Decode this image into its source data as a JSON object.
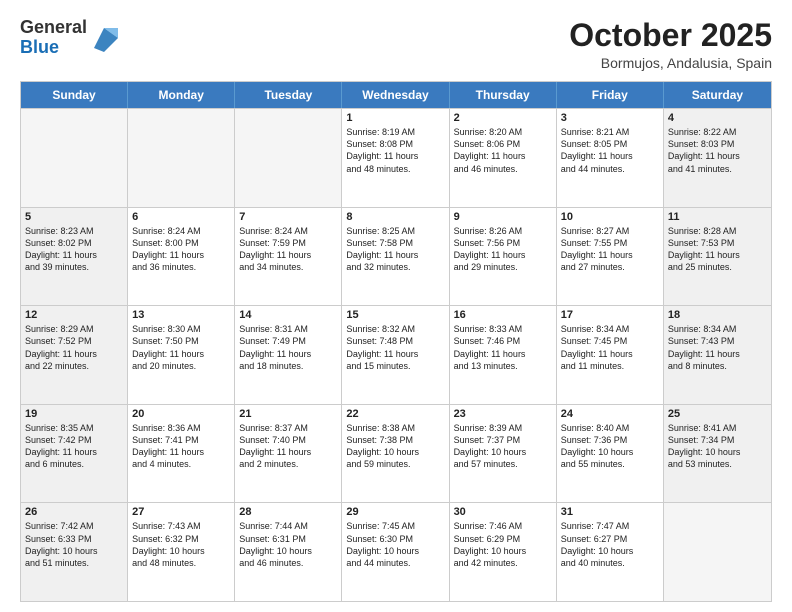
{
  "header": {
    "logo_line1": "General",
    "logo_line2": "Blue",
    "month": "October 2025",
    "location": "Bormujos, Andalusia, Spain"
  },
  "days_of_week": [
    "Sunday",
    "Monday",
    "Tuesday",
    "Wednesday",
    "Thursday",
    "Friday",
    "Saturday"
  ],
  "weeks": [
    [
      {
        "day": "",
        "info": "",
        "empty": true
      },
      {
        "day": "",
        "info": "",
        "empty": true
      },
      {
        "day": "",
        "info": "",
        "empty": true
      },
      {
        "day": "1",
        "info": "Sunrise: 8:19 AM\nSunset: 8:08 PM\nDaylight: 11 hours\nand 48 minutes.",
        "empty": false
      },
      {
        "day": "2",
        "info": "Sunrise: 8:20 AM\nSunset: 8:06 PM\nDaylight: 11 hours\nand 46 minutes.",
        "empty": false
      },
      {
        "day": "3",
        "info": "Sunrise: 8:21 AM\nSunset: 8:05 PM\nDaylight: 11 hours\nand 44 minutes.",
        "empty": false
      },
      {
        "day": "4",
        "info": "Sunrise: 8:22 AM\nSunset: 8:03 PM\nDaylight: 11 hours\nand 41 minutes.",
        "empty": false,
        "shaded": true
      }
    ],
    [
      {
        "day": "5",
        "info": "Sunrise: 8:23 AM\nSunset: 8:02 PM\nDaylight: 11 hours\nand 39 minutes.",
        "empty": false,
        "shaded": true
      },
      {
        "day": "6",
        "info": "Sunrise: 8:24 AM\nSunset: 8:00 PM\nDaylight: 11 hours\nand 36 minutes.",
        "empty": false
      },
      {
        "day": "7",
        "info": "Sunrise: 8:24 AM\nSunset: 7:59 PM\nDaylight: 11 hours\nand 34 minutes.",
        "empty": false
      },
      {
        "day": "8",
        "info": "Sunrise: 8:25 AM\nSunset: 7:58 PM\nDaylight: 11 hours\nand 32 minutes.",
        "empty": false
      },
      {
        "day": "9",
        "info": "Sunrise: 8:26 AM\nSunset: 7:56 PM\nDaylight: 11 hours\nand 29 minutes.",
        "empty": false
      },
      {
        "day": "10",
        "info": "Sunrise: 8:27 AM\nSunset: 7:55 PM\nDaylight: 11 hours\nand 27 minutes.",
        "empty": false
      },
      {
        "day": "11",
        "info": "Sunrise: 8:28 AM\nSunset: 7:53 PM\nDaylight: 11 hours\nand 25 minutes.",
        "empty": false,
        "shaded": true
      }
    ],
    [
      {
        "day": "12",
        "info": "Sunrise: 8:29 AM\nSunset: 7:52 PM\nDaylight: 11 hours\nand 22 minutes.",
        "empty": false,
        "shaded": true
      },
      {
        "day": "13",
        "info": "Sunrise: 8:30 AM\nSunset: 7:50 PM\nDaylight: 11 hours\nand 20 minutes.",
        "empty": false
      },
      {
        "day": "14",
        "info": "Sunrise: 8:31 AM\nSunset: 7:49 PM\nDaylight: 11 hours\nand 18 minutes.",
        "empty": false
      },
      {
        "day": "15",
        "info": "Sunrise: 8:32 AM\nSunset: 7:48 PM\nDaylight: 11 hours\nand 15 minutes.",
        "empty": false
      },
      {
        "day": "16",
        "info": "Sunrise: 8:33 AM\nSunset: 7:46 PM\nDaylight: 11 hours\nand 13 minutes.",
        "empty": false
      },
      {
        "day": "17",
        "info": "Sunrise: 8:34 AM\nSunset: 7:45 PM\nDaylight: 11 hours\nand 11 minutes.",
        "empty": false
      },
      {
        "day": "18",
        "info": "Sunrise: 8:34 AM\nSunset: 7:43 PM\nDaylight: 11 hours\nand 8 minutes.",
        "empty": false,
        "shaded": true
      }
    ],
    [
      {
        "day": "19",
        "info": "Sunrise: 8:35 AM\nSunset: 7:42 PM\nDaylight: 11 hours\nand 6 minutes.",
        "empty": false,
        "shaded": true
      },
      {
        "day": "20",
        "info": "Sunrise: 8:36 AM\nSunset: 7:41 PM\nDaylight: 11 hours\nand 4 minutes.",
        "empty": false
      },
      {
        "day": "21",
        "info": "Sunrise: 8:37 AM\nSunset: 7:40 PM\nDaylight: 11 hours\nand 2 minutes.",
        "empty": false
      },
      {
        "day": "22",
        "info": "Sunrise: 8:38 AM\nSunset: 7:38 PM\nDaylight: 10 hours\nand 59 minutes.",
        "empty": false
      },
      {
        "day": "23",
        "info": "Sunrise: 8:39 AM\nSunset: 7:37 PM\nDaylight: 10 hours\nand 57 minutes.",
        "empty": false
      },
      {
        "day": "24",
        "info": "Sunrise: 8:40 AM\nSunset: 7:36 PM\nDaylight: 10 hours\nand 55 minutes.",
        "empty": false
      },
      {
        "day": "25",
        "info": "Sunrise: 8:41 AM\nSunset: 7:34 PM\nDaylight: 10 hours\nand 53 minutes.",
        "empty": false,
        "shaded": true
      }
    ],
    [
      {
        "day": "26",
        "info": "Sunrise: 7:42 AM\nSunset: 6:33 PM\nDaylight: 10 hours\nand 51 minutes.",
        "empty": false,
        "shaded": true
      },
      {
        "day": "27",
        "info": "Sunrise: 7:43 AM\nSunset: 6:32 PM\nDaylight: 10 hours\nand 48 minutes.",
        "empty": false
      },
      {
        "day": "28",
        "info": "Sunrise: 7:44 AM\nSunset: 6:31 PM\nDaylight: 10 hours\nand 46 minutes.",
        "empty": false
      },
      {
        "day": "29",
        "info": "Sunrise: 7:45 AM\nSunset: 6:30 PM\nDaylight: 10 hours\nand 44 minutes.",
        "empty": false
      },
      {
        "day": "30",
        "info": "Sunrise: 7:46 AM\nSunset: 6:29 PM\nDaylight: 10 hours\nand 42 minutes.",
        "empty": false
      },
      {
        "day": "31",
        "info": "Sunrise: 7:47 AM\nSunset: 6:27 PM\nDaylight: 10 hours\nand 40 minutes.",
        "empty": false
      },
      {
        "day": "",
        "info": "",
        "empty": true,
        "shaded": true
      }
    ]
  ]
}
